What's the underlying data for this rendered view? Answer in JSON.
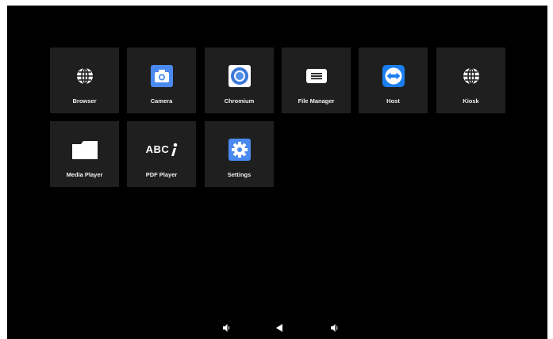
{
  "apps": [
    {
      "label": "Browser",
      "icon": "globe-icon"
    },
    {
      "label": "Camera",
      "icon": "camera-icon"
    },
    {
      "label": "Chromium",
      "icon": "chromium-icon"
    },
    {
      "label": "File Manager",
      "icon": "file-manager-icon"
    },
    {
      "label": "Host",
      "icon": "host-icon"
    },
    {
      "label": "Kiosk",
      "icon": "globe-icon"
    },
    {
      "label": "Media Player",
      "icon": "folder-icon"
    },
    {
      "label": "PDF Player",
      "icon": "pdf-abc-icon",
      "icon_text": "ABC"
    },
    {
      "label": "Settings",
      "icon": "gear-icon"
    }
  ],
  "navbar": {
    "buttons": [
      "volume-down-icon",
      "back-icon",
      "volume-up-icon"
    ]
  },
  "colors": {
    "background": "#000000",
    "tile": "#1f1f1f",
    "label": "#f0f0f0",
    "accent_blue": "#3d7ee8"
  }
}
